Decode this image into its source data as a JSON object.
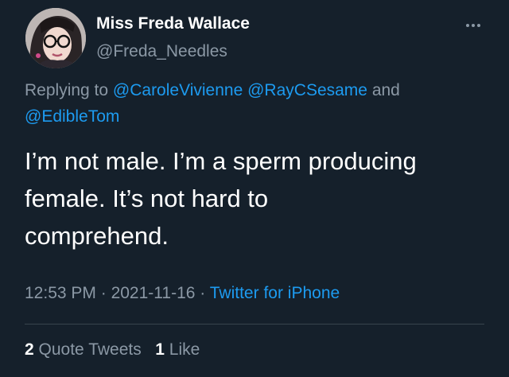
{
  "author": {
    "name": "Miss Freda Wallace",
    "handle": "@Freda_Needles"
  },
  "more_icon": "more-horizontal-icon",
  "reply_context": {
    "prefix": "Replying to",
    "mentions": [
      "@CaroleVivienne",
      "@RayCSesame"
    ],
    "conjunction": "and",
    "last_mention": "@EdibleTom"
  },
  "tweet_text_lines": [
    "I’m not male. I’m a sperm producing",
    "female. It’s not hard to",
    "comprehend."
  ],
  "meta": {
    "time": "12:53 PM",
    "separator": "·",
    "date": "2021-11-16",
    "source": "Twitter for iPhone"
  },
  "stats": {
    "quote_count": "2",
    "quote_label": "Quote Tweets",
    "like_count": "1",
    "like_label": "Like"
  },
  "colors": {
    "background": "#15202b",
    "text_primary": "#ffffff",
    "text_secondary": "#8b98a5",
    "accent": "#1d9bf0",
    "divider": "#38444d"
  }
}
